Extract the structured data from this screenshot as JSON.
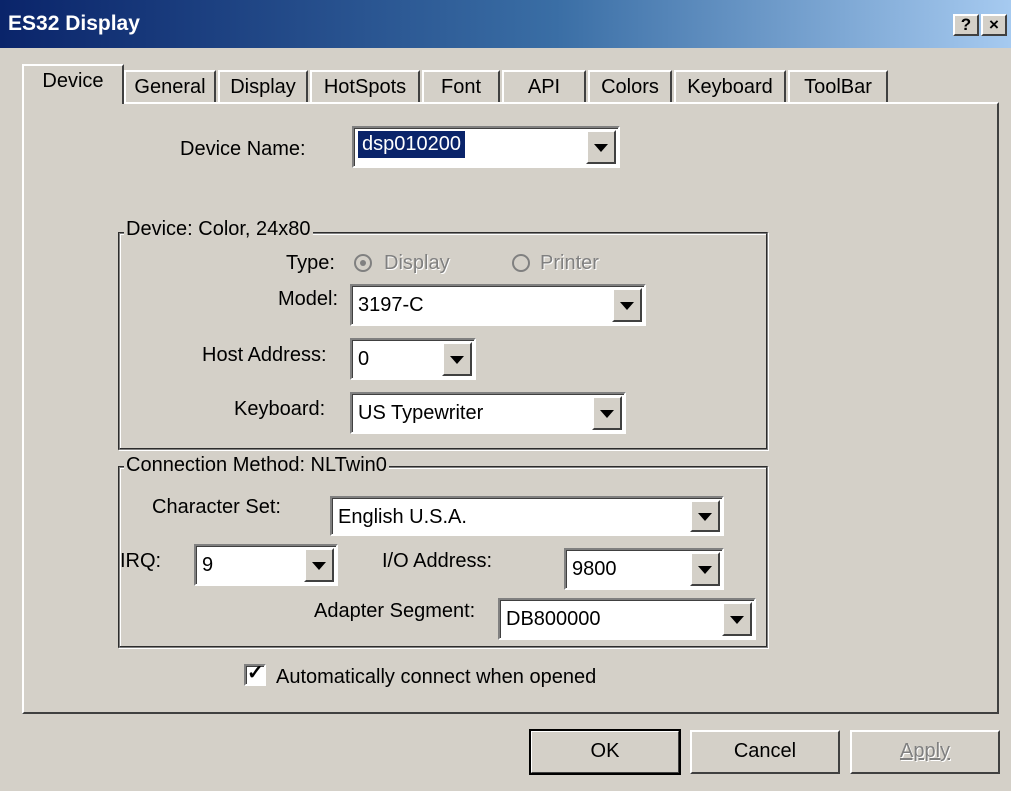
{
  "window": {
    "title": "ES32 Display",
    "help_label": "?",
    "close_label": "×"
  },
  "tabs": [
    "Device",
    "General",
    "Display",
    "HotSpots",
    "Font",
    "API",
    "Colors",
    "Keyboard",
    "ToolBar"
  ],
  "device": {
    "name_label": "Device Name:",
    "name_value": "dsp010200",
    "group_title": "Device: Color, 24x80",
    "type_label": "Type:",
    "type_options": [
      "Display",
      "Printer"
    ],
    "type_selected": "Display",
    "model_label": "Model:",
    "model_value": "3197-C",
    "host_label": "Host Address:",
    "host_value": "0",
    "keyboard_label": "Keyboard:",
    "keyboard_value": "US Typewriter"
  },
  "connection": {
    "group_title": "Connection Method: NLTwin0",
    "charset_label": "Character Set:",
    "charset_value": "English U.S.A.",
    "irq_label": "IRQ:",
    "irq_value": "9",
    "io_label": "I/O Address:",
    "io_value": "9800",
    "segment_label": "Adapter Segment:",
    "segment_value": "DB800000"
  },
  "auto_connect": {
    "label": "Automatically connect when opened",
    "checked": true
  },
  "buttons": {
    "ok": "OK",
    "cancel": "Cancel",
    "apply": "Apply"
  }
}
